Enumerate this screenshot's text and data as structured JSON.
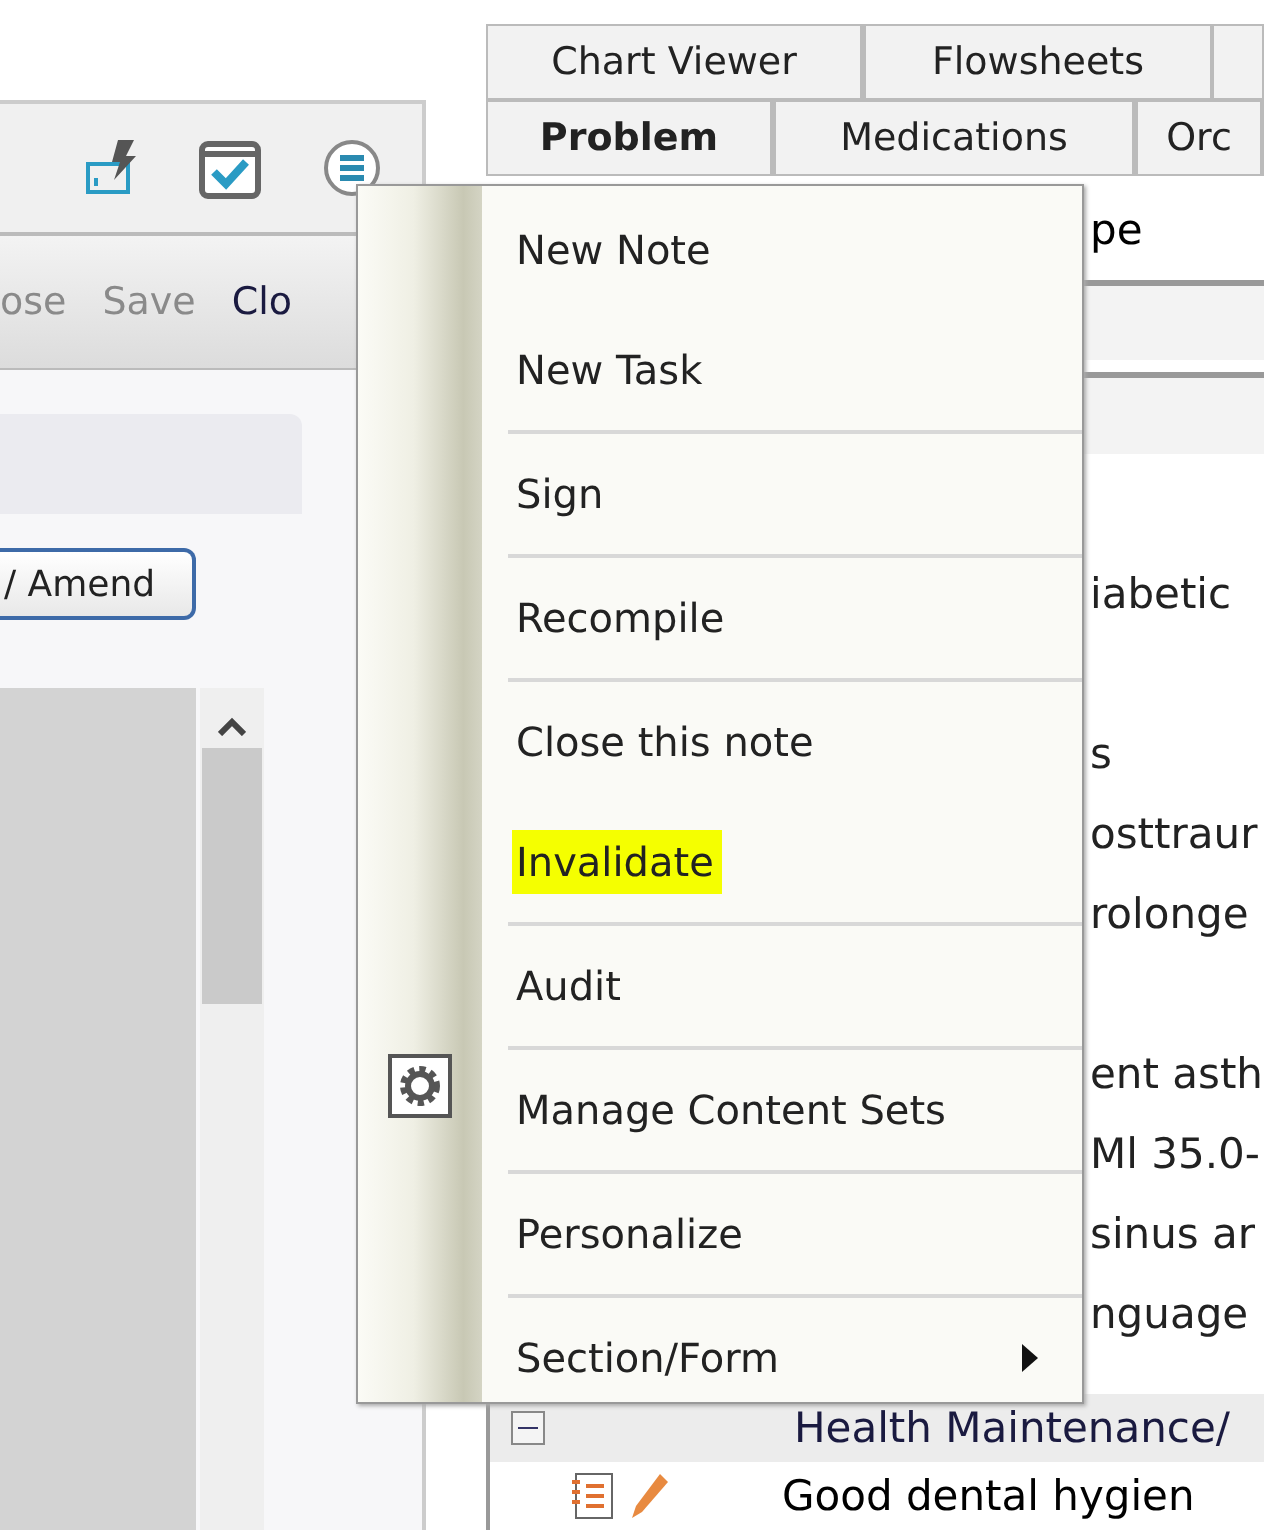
{
  "left_pane": {
    "actions": [
      {
        "label": "ose",
        "enabled": false
      },
      {
        "label": "Save",
        "enabled": false
      },
      {
        "label": "Clo",
        "enabled": true
      }
    ],
    "amend_button": "/ Amend"
  },
  "tabs": [
    [
      {
        "label": "Chart Viewer",
        "selected": false
      },
      {
        "label": "Flowsheets",
        "selected": false
      }
    ],
    [
      {
        "label": "Problem",
        "selected": true
      },
      {
        "label": "Medications",
        "selected": false
      },
      {
        "label": "Orc",
        "selected": false
      }
    ]
  ],
  "right_pane": {
    "field_value": "pe",
    "line_groups": [
      [
        "iabetic"
      ],
      [
        "s",
        "osttraur",
        "rolonge"
      ],
      [
        "ent asth",
        "Ml 35.0-",
        "sinus ar",
        "nguage"
      ]
    ],
    "section": {
      "title": "Health Maintenance/",
      "expanded": true
    },
    "entries": [
      "Good dental hygien"
    ]
  },
  "menu": {
    "groups": [
      [
        {
          "label": "New Note",
          "kind": "plain",
          "highlighted": false
        },
        {
          "label": "New Task",
          "kind": "plain",
          "highlighted": false
        }
      ],
      [
        {
          "label": "Sign",
          "kind": "plain",
          "highlighted": false
        }
      ],
      [
        {
          "label": "Recompile",
          "kind": "plain",
          "highlighted": false
        }
      ],
      [
        {
          "label": "Close this note",
          "kind": "plain",
          "highlighted": false
        },
        {
          "label": "Invalidate",
          "kind": "plain",
          "highlighted": true
        }
      ],
      [
        {
          "label": "Audit",
          "kind": "plain",
          "highlighted": false
        }
      ],
      [
        {
          "label": "Manage Content Sets",
          "kind": "icon",
          "highlighted": false
        }
      ],
      [
        {
          "label": "Personalize",
          "kind": "plain",
          "highlighted": false
        }
      ],
      [
        {
          "label": "Section/Form",
          "kind": "submenu",
          "highlighted": false
        }
      ]
    ]
  }
}
